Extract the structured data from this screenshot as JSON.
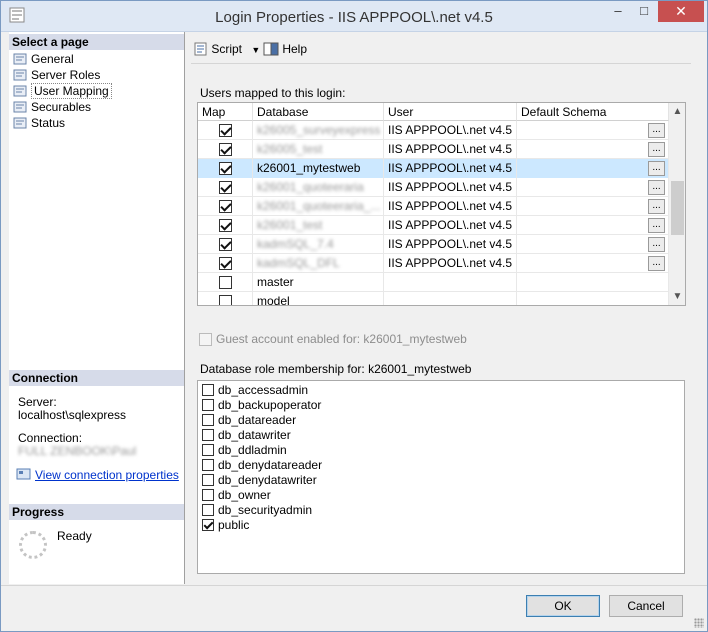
{
  "window": {
    "title": "Login Properties - IIS APPPOOL\\.net v4.5",
    "controls": {
      "minimize": "–",
      "maximize": "□",
      "close": "✕"
    }
  },
  "left": {
    "select_page_header": "Select a page",
    "pages": [
      {
        "label": "General",
        "icon": "page-icon"
      },
      {
        "label": "Server Roles",
        "icon": "page-icon"
      },
      {
        "label": "User Mapping",
        "icon": "page-icon",
        "selected": true
      },
      {
        "label": "Securables",
        "icon": "page-icon"
      },
      {
        "label": "Status",
        "icon": "page-icon"
      }
    ],
    "connection_header": "Connection",
    "server_label": "Server:",
    "server_value": "localhost\\sqlexpress",
    "connection_label": "Connection:",
    "connection_value": "FULL ZENBOOK\\Paul",
    "view_connection_link": "View connection properties",
    "progress_header": "Progress",
    "progress_status": "Ready"
  },
  "toolbar": {
    "script_label": "Script",
    "help_label": "Help"
  },
  "users_mapped_label": "Users mapped to this login:",
  "grid": {
    "columns": [
      "Map",
      "Database",
      "User",
      "Default Schema"
    ],
    "rows": [
      {
        "map": true,
        "database": "k26005_surveyexpress",
        "user": "IIS APPPOOL\\.net v4.5",
        "schema": "",
        "blurred": true,
        "has_button": true
      },
      {
        "map": true,
        "database": "k26005_test",
        "user": "IIS APPPOOL\\.net v4.5",
        "schema": "",
        "blurred": true,
        "has_button": true
      },
      {
        "map": true,
        "database": "k26001_mytestweb",
        "user": "IIS APPPOOL\\.net v4.5",
        "schema": "",
        "blurred": false,
        "has_button": true,
        "selected": true
      },
      {
        "map": true,
        "database": "k26001_quoteeraria",
        "user": "IIS APPPOOL\\.net v4.5",
        "schema": "",
        "blurred": true,
        "has_button": true
      },
      {
        "map": true,
        "database": "k26001_quoteeraria_...",
        "user": "IIS APPPOOL\\.net v4.5",
        "schema": "",
        "blurred": true,
        "has_button": true
      },
      {
        "map": true,
        "database": "k26001_test",
        "user": "IIS APPPOOL\\.net v4.5",
        "schema": "",
        "blurred": true,
        "has_button": true
      },
      {
        "map": true,
        "database": "kadmSQL_7.4",
        "user": "IIS APPPOOL\\.net v4.5",
        "schema": "",
        "blurred": true,
        "has_button": true
      },
      {
        "map": true,
        "database": "kadmSQL_DFL",
        "user": "IIS APPPOOL\\.net v4.5",
        "schema": "",
        "blurred": true,
        "has_button": true
      },
      {
        "map": false,
        "database": "master",
        "user": "",
        "schema": "",
        "blurred": false,
        "has_button": false
      },
      {
        "map": false,
        "database": "model",
        "user": "",
        "schema": "",
        "blurred": false,
        "has_button": false
      }
    ]
  },
  "guest_label": "Guest account enabled for: k26001_mytestweb",
  "role_membership_label": "Database role membership for: k26001_mytestweb",
  "roles": [
    {
      "label": "db_accessadmin",
      "checked": false
    },
    {
      "label": "db_backupoperator",
      "checked": false
    },
    {
      "label": "db_datareader",
      "checked": false
    },
    {
      "label": "db_datawriter",
      "checked": false
    },
    {
      "label": "db_ddladmin",
      "checked": false
    },
    {
      "label": "db_denydatareader",
      "checked": false
    },
    {
      "label": "db_denydatawriter",
      "checked": false
    },
    {
      "label": "db_owner",
      "checked": false
    },
    {
      "label": "db_securityadmin",
      "checked": false
    },
    {
      "label": "public",
      "checked": true
    }
  ],
  "buttons": {
    "ok": "OK",
    "cancel": "Cancel"
  }
}
